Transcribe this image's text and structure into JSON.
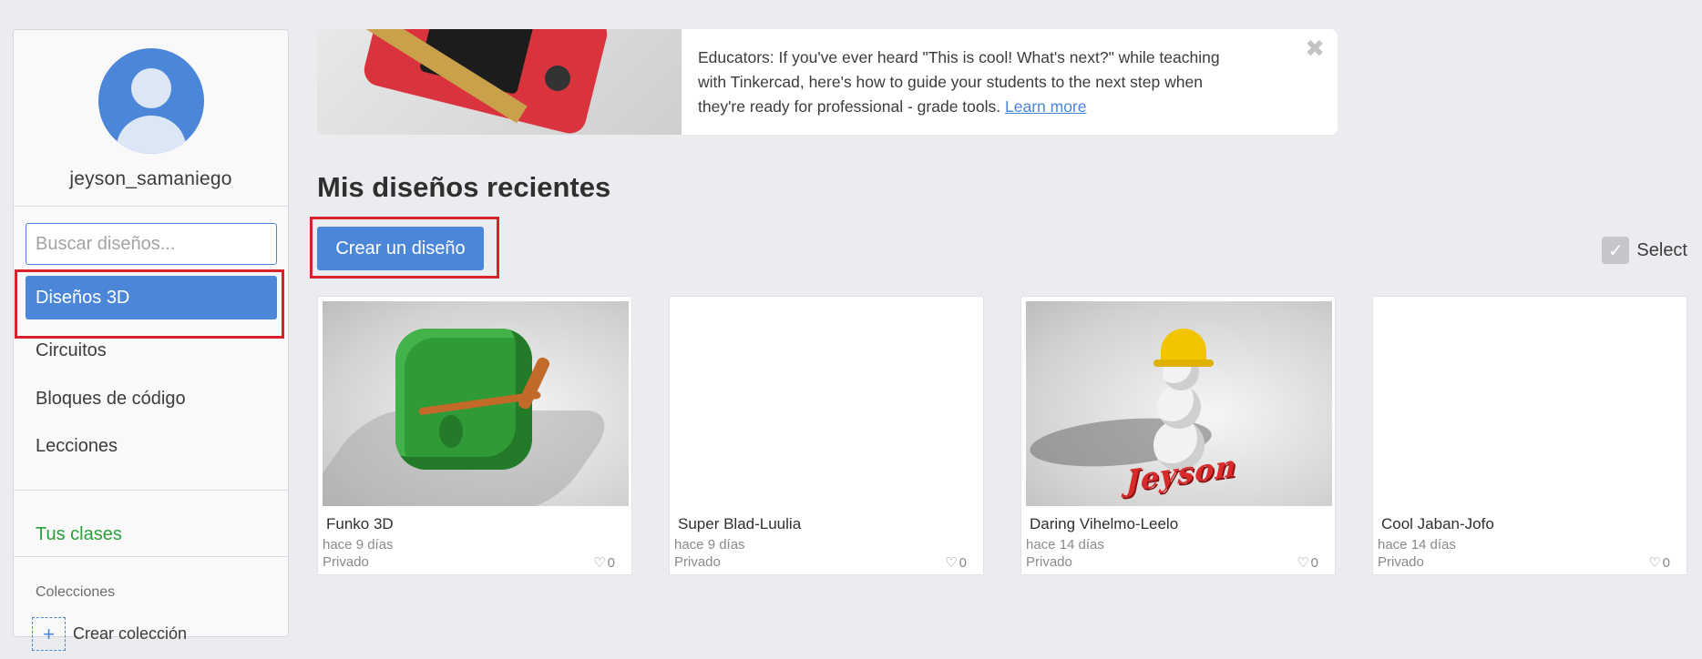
{
  "sidebar": {
    "username": "jeyson_samaniego",
    "search_placeholder": "Buscar diseños...",
    "nav": {
      "active": "Diseños 3D",
      "circuits": "Circuitos",
      "codeblocks": "Bloques de código",
      "lessons": "Lecciones"
    },
    "classes": "Tus clases",
    "collections_title": "Colecciones",
    "create_collection": "Crear colección"
  },
  "banner": {
    "text": "Educators: If you've ever heard \"This is cool! What's next?\" while teaching with Tinkercad, here's how to guide your students to the next step when they're ready for professional - grade tools. ",
    "link": "Learn more",
    "close": "✖"
  },
  "main": {
    "title": "Mis diseños recientes",
    "create_button": "Crear un diseño",
    "select_label": "Select"
  },
  "designs": [
    {
      "name": "Funko 3D",
      "date": "hace 9 días",
      "privacy": "Privado",
      "likes": "0"
    },
    {
      "name": "Super Blad-Luulia",
      "date": "hace 9 días",
      "privacy": "Privado",
      "likes": "0"
    },
    {
      "name": "Daring Vihelmo-Leelo",
      "date": "hace 14 días",
      "privacy": "Privado",
      "likes": "0"
    },
    {
      "name": "Cool Jaban-Jofo",
      "date": "hace 14 días",
      "privacy": "Privado",
      "likes": "0"
    }
  ],
  "thumb_text": {
    "snowman": "Jeyson"
  },
  "colors": {
    "accent": "#4b86d8",
    "highlight": "#d7222c",
    "classes": "#2b9e3c"
  }
}
